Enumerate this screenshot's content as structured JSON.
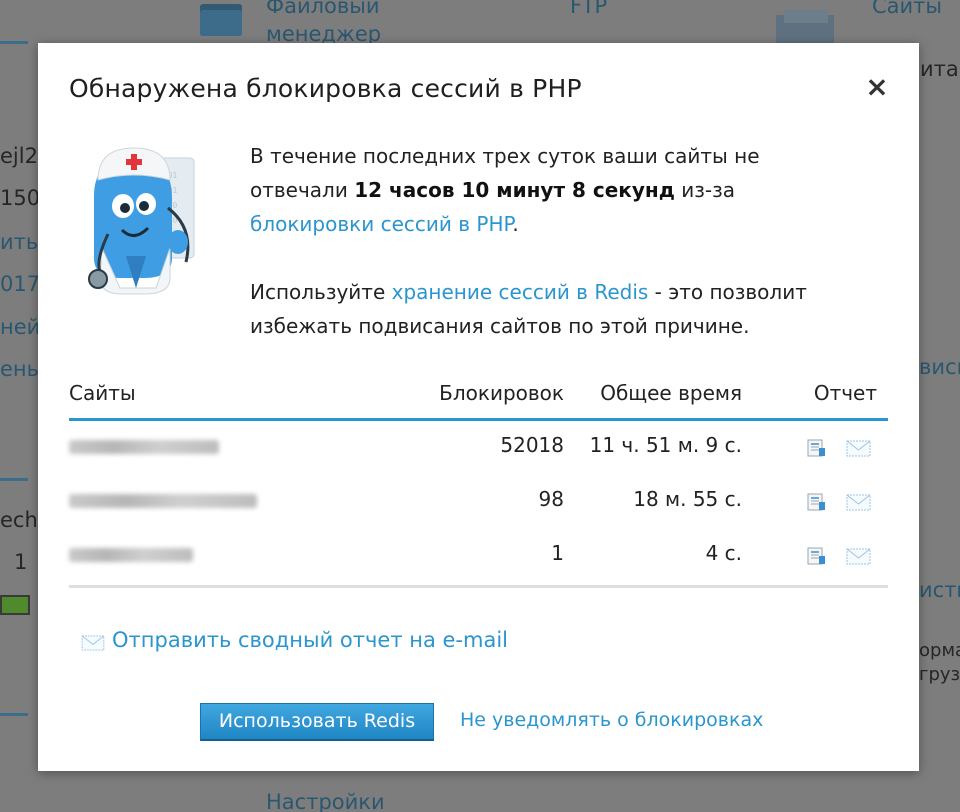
{
  "background": {
    "top_items": [
      "Файловый",
      "менеджер",
      "FTP",
      "Сайты"
    ],
    "left_fragments": [
      "ejl2",
      "150",
      "ить",
      "017",
      "ней",
      "ень",
      "ech",
      "1"
    ],
    "right_fragments": [
      "ита",
      "висы",
      "исти",
      "орма",
      "грузк"
    ],
    "bottom_item": "Настройки"
  },
  "modal": {
    "title": "Обнаружена блокировка сессий в PHP",
    "close_glyph": "×",
    "intro": {
      "line1": "В течение последних трех суток ваши сайты не отвечали ",
      "duration": "12 часов 10 минут 8 секунд",
      "mid": " из-за ",
      "lock_link": "блокировки сессий в PHP",
      "end": ".",
      "advice_prefix": "Используйте ",
      "redis_link": "хранение сессий в Redis",
      "advice_suffix": " - это позволит избежать подвисания сайтов по этой причине."
    },
    "table": {
      "headers": {
        "sites": "Сайты",
        "locks": "Блокировок",
        "total_time": "Общее время",
        "report": "Отчет"
      },
      "rows": [
        {
          "locks": "52018",
          "time": "11 ч. 51 м. 9 с."
        },
        {
          "locks": "98",
          "time": "18 м. 55 с."
        },
        {
          "locks": "1",
          "time": "4 с."
        }
      ]
    },
    "summary_link": "Отправить сводный отчет на e-mail",
    "primary_button": "Использовать Redis",
    "secondary_link": "Не уведомлять о блокировках"
  },
  "colors": {
    "accent": "#2b95cf",
    "overlay": "#7d7d7d"
  },
  "icons": [
    "close-icon",
    "doctor-mascot",
    "report-document-icon",
    "email-envelope-icon"
  ]
}
